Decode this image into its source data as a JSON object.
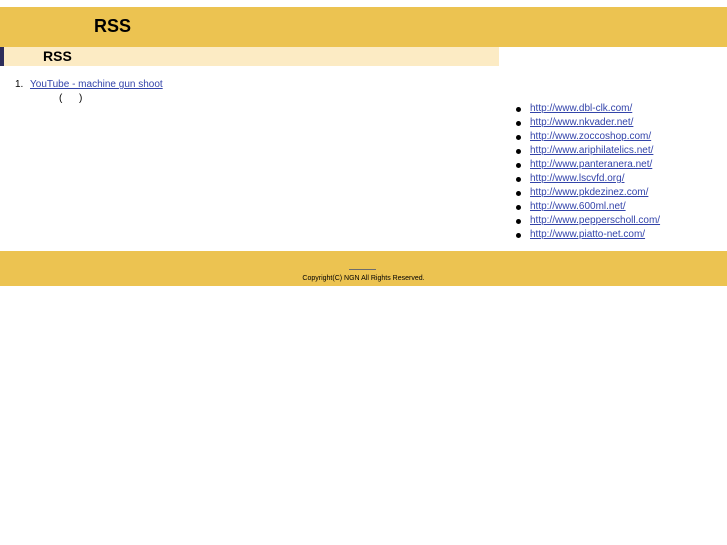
{
  "header": {
    "title": "RSS"
  },
  "section": {
    "title": "RSS"
  },
  "feed": {
    "items": [
      {
        "number": "1.",
        "link_text": "YouTube - machine gun shoot",
        "meta": "(      )"
      }
    ]
  },
  "links": [
    "http://www.dbl-clk.com/",
    "http://www.nkvader.net/",
    "http://www.zoccoshop.com/",
    "http://www.ariphilatelics.net/",
    "http://www.panteranera.net/",
    "http://www.lscvfd.org/",
    "http://www.pkdezinez.com/",
    "http://www.600ml.net/",
    "http://www.pepperscholl.com/",
    "http://www.piatto-net.com/"
  ],
  "footer": {
    "copyright": "Copyright(C) NGN All Rights Reserved."
  },
  "colors": {
    "header_bg": "#ecc351",
    "section_bg": "#fcebc4",
    "link": "#3344aa",
    "accent_bar": "#2d2d5a"
  }
}
